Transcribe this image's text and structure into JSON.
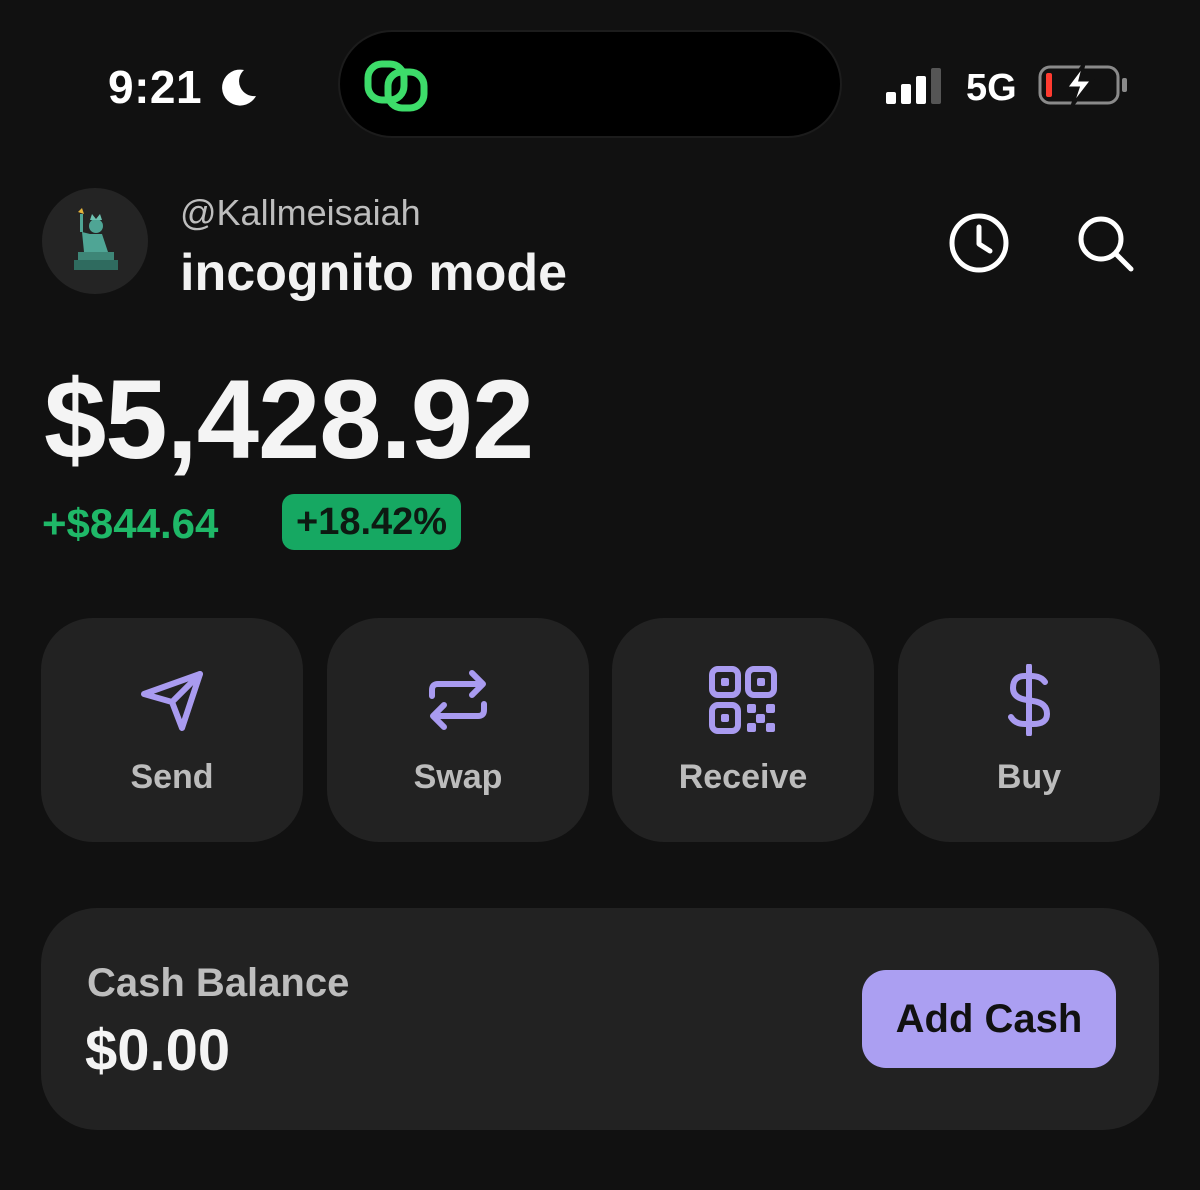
{
  "status_bar": {
    "time": "9:21",
    "network": "5G",
    "icons": [
      "moon-icon",
      "app-link-icon",
      "signal-icon",
      "battery-charging-icon"
    ]
  },
  "header": {
    "username": "@Kallmeisaiah",
    "account_name": "incognito mode",
    "avatar": "statue-of-liberty-avatar",
    "icons": [
      "clock-icon",
      "search-icon"
    ]
  },
  "balance": {
    "total": "$5,428.92",
    "change_amount": "+$844.64",
    "change_percent": "+18.42%"
  },
  "actions": [
    {
      "label": "Send",
      "icon": "send-icon"
    },
    {
      "label": "Swap",
      "icon": "swap-icon"
    },
    {
      "label": "Receive",
      "icon": "qr-code-icon"
    },
    {
      "label": "Buy",
      "icon": "dollar-icon"
    }
  ],
  "cash": {
    "label": "Cash Balance",
    "value": "$0.00",
    "button_label": "Add Cash"
  },
  "colors": {
    "background": "#111111",
    "card": "#222222",
    "accent_purple": "#ab9ff2",
    "icon_purple": "#a99bf0",
    "positive_green": "#1fb868",
    "badge_green": "#16a862"
  }
}
